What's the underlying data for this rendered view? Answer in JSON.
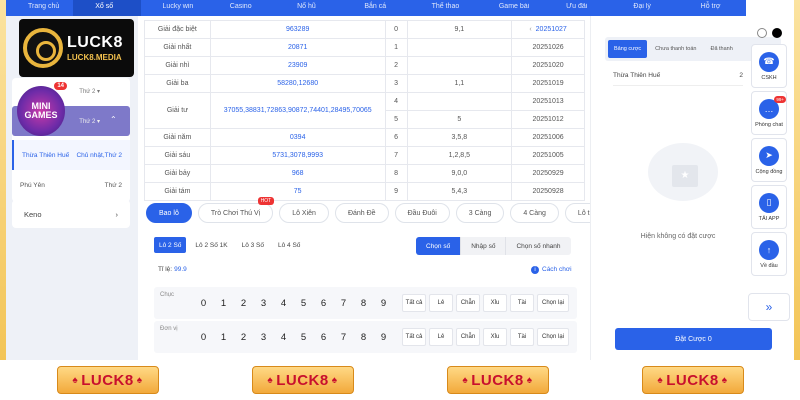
{
  "topnav": {
    "items": [
      "Trang chủ",
      "Xổ số",
      "Lucky win",
      "Casino",
      "Nổ hũ",
      "Bắn cá",
      "Thể thao",
      "Game bài",
      "Ưu đãi",
      "Đại lý",
      "Hỗ trợ"
    ]
  },
  "logo": {
    "title": "LUCK8",
    "domain": "LUCK8.MEDIA"
  },
  "minigames": {
    "line1": "MINI",
    "line2": "GAMES",
    "badge": "14"
  },
  "left": {
    "row1_days": "Thứ 2 ▾",
    "row2_days": "Thứ 2 ▾",
    "regions": [
      {
        "name": "Thừa Thiên Huế",
        "days": "Chủ nhật,Thứ 2"
      },
      {
        "name": "Phú Yên",
        "days": "Thứ 2"
      }
    ],
    "keno": "Keno"
  },
  "results": {
    "rows": [
      {
        "name": "Giải đặc biệt",
        "value": "963289",
        "idx": "0",
        "cell": "9,1",
        "date": "20251027"
      },
      {
        "name": "Giải nhất",
        "value": "20871",
        "idx": "1",
        "cell": "",
        "date": "20251026"
      },
      {
        "name": "Giải nhì",
        "value": "23909",
        "idx": "2",
        "cell": "",
        "date": "20251020"
      },
      {
        "name": "Giải ba",
        "value": "58280,12680",
        "idx": "3",
        "cell": "1,1",
        "date": "20251019"
      },
      {
        "name": "Giải tư",
        "value": "37055,38831,72863,90872,74401,28495,70065",
        "idx": "4",
        "cell": "",
        "date": "20251013"
      },
      {
        "name": "",
        "value": "",
        "idx": "5",
        "cell": "5",
        "date": "20251012"
      },
      {
        "name": "Giải năm",
        "value": "0394",
        "idx": "6",
        "cell": "3,5,8",
        "date": "20251006"
      },
      {
        "name": "Giải sáu",
        "value": "5731,3078,9993",
        "idx": "7",
        "cell": "1,2,8,5",
        "date": "20251005"
      },
      {
        "name": "Giải bảy",
        "value": "968",
        "idx": "8",
        "cell": "9,0,0",
        "date": "20250929"
      },
      {
        "name": "Giải tám",
        "value": "75",
        "idx": "9",
        "cell": "5,4,3",
        "date": "20250928"
      }
    ]
  },
  "modes": {
    "items": [
      "Bao lô",
      "Trò Chơi Thú Vị",
      "Lô Xiên",
      "Đánh Đề",
      "Đầu Đuôi",
      "3 Càng",
      "4 Càng",
      "Lô trượt"
    ],
    "hot": "HOT"
  },
  "sub": {
    "items": [
      "Lô 2 Số",
      "Lô 2 Số 1K",
      "Lô 3 Số",
      "Lô 4 Số"
    ]
  },
  "inputmode": {
    "items": [
      "Chọn số",
      "Nhập số",
      "Chọn số nhanh"
    ]
  },
  "rate": {
    "label": "Tỉ lệ:",
    "value": "99.9"
  },
  "howto": "Cách chơi",
  "rows": {
    "tens": "Chục",
    "units": "Đơn vị"
  },
  "digits": [
    "0",
    "1",
    "2",
    "3",
    "4",
    "5",
    "6",
    "7",
    "8",
    "9"
  ],
  "quick": [
    "Tất cả",
    "Lẻ",
    "Chẵn",
    "Xỉu",
    "Tài",
    "Chọn lại"
  ],
  "right": {
    "tabs": [
      "Bảng cược",
      "Chưa thanh toán",
      "Đã thanh"
    ],
    "province": "Thừa Thiên Huế",
    "province_code": "2",
    "empty": "Hiện không có đặt cược",
    "bet_button": "Đặt Cược 0"
  },
  "side": {
    "buttons": [
      {
        "label": "CSKH",
        "icon": "headset-icon"
      },
      {
        "label": "Phòng chat",
        "icon": "chat-icon",
        "badge": "99+"
      },
      {
        "label": "Cộng đồng",
        "icon": "send-icon"
      },
      {
        "label": "TẢI APP",
        "icon": "phone-icon"
      },
      {
        "label": "Về đầu",
        "icon": "arrow-up-icon"
      }
    ]
  },
  "footer": {
    "badge": "LUCK8"
  },
  "colors": {
    "primary": "#2a62e8",
    "gold": "#f2c14e",
    "red": "#c8102e"
  }
}
